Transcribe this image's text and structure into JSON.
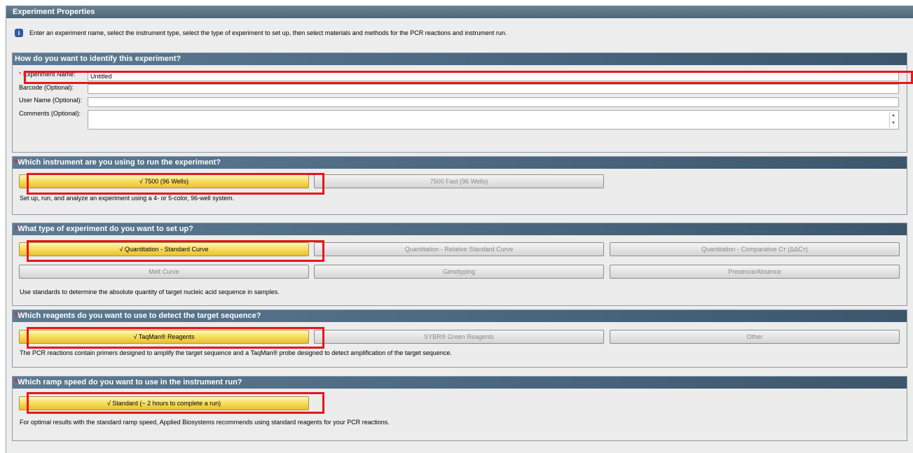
{
  "header": {
    "title": "Experiment Properties"
  },
  "intro": {
    "text": "Enter an experiment name, select the instrument type, select the type of experiment to set up, then select materials and methods for the PCR reactions and instrument run."
  },
  "identify": {
    "heading": "How do you want to identify this experiment?",
    "fields": [
      {
        "label": "Experiment Name:",
        "value": "Untitled",
        "required": true
      },
      {
        "label": "Barcode (Optional):",
        "value": ""
      },
      {
        "label": "User Name (Optional):",
        "value": ""
      },
      {
        "label": "Comments (Optional):",
        "value": ""
      }
    ]
  },
  "instrument": {
    "heading": "Which instrument are you using to run the experiment?",
    "options": [
      "√ 7500 (96 Wells)",
      "7500 Fast (96 Wells)"
    ],
    "selected": 0,
    "description": "Set up, run, and analyze an experiment using a 4- or 5-color, 96-well system."
  },
  "experiment_type": {
    "heading": "What type of experiment do you want to set up?",
    "options": [
      "√ Quantitation - Standard Curve",
      "Quantitation - Relative Standard Curve",
      "Quantitation - Comparative Cт (ΔΔCт)",
      "Melt Curve",
      "Genotyping",
      "Presence/Absence"
    ],
    "selected": 0,
    "description": "Use standards to determine the absolute quantity of target nucleic acid sequence in samples."
  },
  "reagents": {
    "heading": "Which reagents do you want to use to detect the target sequence?",
    "options": [
      "√ TaqMan® Reagents",
      "SYBR® Green Reagents",
      "Other"
    ],
    "selected": 0,
    "description": "The PCR reactions contain primers designed to amplify the target sequence and a TaqMan® probe designed to detect amplification of the target sequence."
  },
  "ramp": {
    "heading": "Which ramp speed do you want to use in the instrument run?",
    "options": [
      "√ Standard (~ 2 hours to complete a run)"
    ],
    "selected": 0,
    "description": "For optimal results with the standard ramp speed, Applied Biosystems recommends using standard reagents for your PCR reactions."
  },
  "icons": {
    "info": "info-icon",
    "required": "required-asterisk"
  },
  "colors": {
    "selected_button": "#f7da58",
    "section_header": "#4c6678",
    "highlight": "#e8161b"
  }
}
